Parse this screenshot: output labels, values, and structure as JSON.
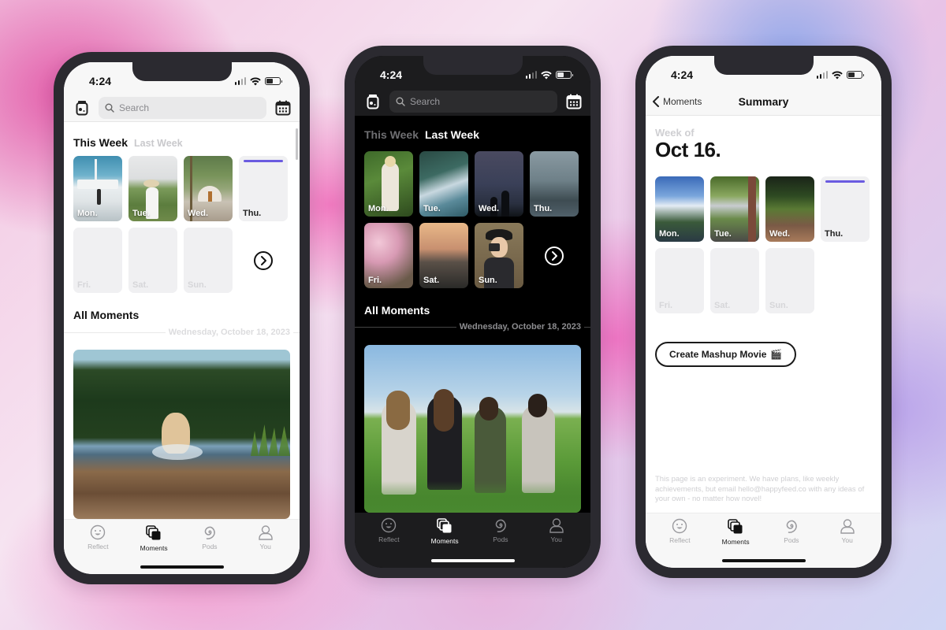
{
  "status_bar": {
    "time": "4:24"
  },
  "phone_light": {
    "theme": "light",
    "header": {
      "search_placeholder": "Search"
    },
    "tabs": [
      {
        "label": "This Week",
        "active": true
      },
      {
        "label": "Last Week",
        "active": false
      }
    ],
    "days": [
      {
        "label": "Mon.",
        "state": "photo",
        "photo": "mosque courtyard"
      },
      {
        "label": "Tue.",
        "state": "photo",
        "photo": "woman in sun hat in tall grass"
      },
      {
        "label": "Wed.",
        "state": "photo",
        "photo": "dome tent in bamboo forest"
      },
      {
        "label": "Thu.",
        "state": "today"
      },
      {
        "label": "Fri.",
        "state": "empty"
      },
      {
        "label": "Sat.",
        "state": "empty"
      },
      {
        "label": "Sun.",
        "state": "empty"
      }
    ],
    "all_moments_title": "All Moments",
    "date_separator": "Wednesday, October 18, 2023",
    "moment_photo": "golden retriever running in lake"
  },
  "phone_dark": {
    "theme": "dark",
    "header": {
      "search_placeholder": "Search"
    },
    "tabs": [
      {
        "label": "This Week",
        "active": false
      },
      {
        "label": "Last Week",
        "active": true
      }
    ],
    "days": [
      {
        "label": "Mon.",
        "state": "photo",
        "photo": "mother holding child in garden"
      },
      {
        "label": "Tue.",
        "state": "photo",
        "photo": "ocean wave aerial"
      },
      {
        "label": "Wed.",
        "state": "photo",
        "photo": "silhouettes under night sky"
      },
      {
        "label": "Thu.",
        "state": "photo",
        "photo": "raindrops on window"
      },
      {
        "label": "Fri.",
        "state": "photo",
        "photo": "pink blossoms"
      },
      {
        "label": "Sat.",
        "state": "photo",
        "photo": "sunset over sea cliffs"
      },
      {
        "label": "Sun.",
        "state": "photo",
        "photo": "woman with camera and hat"
      }
    ],
    "all_moments_title": "All Moments",
    "date_separator": "Wednesday, October 18, 2023",
    "moment_photo": "four friends making heart hands in field"
  },
  "phone_summary": {
    "nav": {
      "back_label": "Moments",
      "title": "Summary"
    },
    "week_of_label": "Week of",
    "week_date": "Oct 16.",
    "days": [
      {
        "label": "Mon.",
        "state": "photo",
        "photo": "park under blue sky"
      },
      {
        "label": "Tue.",
        "state": "photo",
        "photo": "city street with trees"
      },
      {
        "label": "Wed.",
        "state": "photo",
        "photo": "park path at dusk"
      },
      {
        "label": "Thu.",
        "state": "today"
      },
      {
        "label": "Fri.",
        "state": "empty"
      },
      {
        "label": "Sat.",
        "state": "empty"
      },
      {
        "label": "Sun.",
        "state": "empty"
      }
    ],
    "mashup_button": "Create Mashup Movie",
    "mashup_icon": "🎬",
    "note": "This page is an experiment. We have plans, like weekly achievements, but email hello@happyfeed.co with any ideas of your own - no matter how novel!"
  },
  "tab_bar": {
    "items": [
      {
        "label": "Reflect",
        "icon": "smiley-icon",
        "active": false
      },
      {
        "label": "Moments",
        "icon": "stacked-photos-icon",
        "active": true
      },
      {
        "label": "Pods",
        "icon": "spiral-icon",
        "active": false
      },
      {
        "label": "You",
        "icon": "person-icon",
        "active": false
      }
    ]
  },
  "colors": {
    "accent_today_bar": "#6a5be0",
    "frame": "#2b2a30"
  }
}
